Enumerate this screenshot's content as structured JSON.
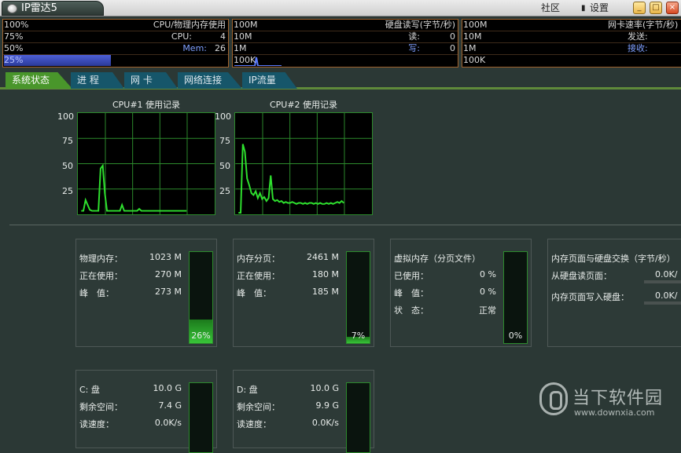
{
  "window": {
    "title": "IP雷达5",
    "community": "社区",
    "settings": "设置",
    "minimize_glyph": "_",
    "maximize_glyph": "□",
    "close_glyph": "×"
  },
  "cpu_panel": {
    "title": "CPU/物理内存使用",
    "rows": [
      "100%",
      "75%",
      "50%",
      "25%"
    ],
    "cpu_label": "CPU:",
    "cpu_value": "4",
    "mem_label": "Mem:",
    "mem_value": "26"
  },
  "disk_panel": {
    "title": "硬盘读写(字节/秒)",
    "rows": [
      "100M",
      "10M",
      "1M",
      "100K"
    ],
    "read_label": "读:",
    "read_value": "0",
    "write_label": "写:",
    "write_value": "0"
  },
  "net_panel": {
    "title": "网卡速率(字节/秒)",
    "rows": [
      "100M",
      "10M",
      "1M",
      "100K"
    ],
    "send_label": "发送:",
    "recv_label": "接收:"
  },
  "tabs": [
    "系统状态",
    "进 程",
    "网 卡",
    "网络连接",
    "IP流量"
  ],
  "charts": {
    "cpu1_title": "CPU#1 使用记录",
    "cpu2_title": "CPU#2 使用记录",
    "yticks": [
      "100",
      "75",
      "50",
      "25"
    ]
  },
  "chart_data": [
    {
      "type": "line",
      "title": "CPU#1 使用记录",
      "ylim": [
        0,
        100
      ],
      "yticks": [
        100,
        75,
        50,
        25
      ],
      "grid": true,
      "values": [
        2,
        2,
        13,
        8,
        3,
        2,
        2,
        2,
        2,
        45,
        48,
        20,
        2,
        2,
        2,
        2,
        2,
        2,
        2,
        8,
        2,
        2,
        2,
        2,
        2,
        2,
        2,
        4,
        2,
        2,
        2,
        2,
        2,
        2,
        2,
        2,
        2,
        2,
        2,
        2,
        2,
        2,
        2,
        2,
        2,
        2,
        2,
        2,
        2,
        2
      ]
    },
    {
      "type": "line",
      "title": "CPU#2 使用记录",
      "ylim": [
        0,
        100
      ],
      "yticks": [
        100,
        75,
        50,
        25
      ],
      "grid": true,
      "values": [
        0,
        0,
        70,
        62,
        35,
        28,
        20,
        18,
        22,
        15,
        20,
        14,
        16,
        12,
        15,
        38,
        14,
        12,
        13,
        11,
        12,
        10,
        11,
        10,
        10,
        11,
        10,
        9,
        10,
        10,
        9,
        10,
        9,
        10,
        10,
        9,
        10,
        9,
        10,
        9,
        9,
        10,
        9,
        10,
        9,
        10,
        11,
        10,
        12,
        10
      ]
    }
  ],
  "physical_memory": {
    "total_label": "物理内存：",
    "total_value": "1023 M",
    "used_label": "正在使用：",
    "used_value": "270 M",
    "peak_label": "峰　值：",
    "peak_value": "273 M",
    "percent": "26%",
    "fill_fraction": 0.26
  },
  "paging": {
    "total_label": "内存分页：",
    "total_value": "2461 M",
    "used_label": "正在使用：",
    "used_value": "180 M",
    "peak_label": "峰　值：",
    "peak_value": "185 M",
    "percent": "7%",
    "fill_fraction": 0.07
  },
  "virtual_memory": {
    "title": "虚拟内存（分页文件）",
    "used_label": "已使用：",
    "used_value": "0 %",
    "peak_label": "峰　值：",
    "peak_value": "0 %",
    "state_label": "状　态：",
    "state_value": "正常",
    "percent": "0%",
    "fill_fraction": 0
  },
  "page_swap": {
    "title": "内存页面与硬盘交换（字节/秒）",
    "read_label": "从硬盘读页面：",
    "read_value": "0.0K/",
    "write_label": "内存页面写入硬盘：",
    "write_value": "0.0K/"
  },
  "drive_c": {
    "label": "C: 盘",
    "size": "10.0 G",
    "free_label": "剩余空间：",
    "free_value": "7.4 G",
    "speed_label": "读速度：",
    "speed_value": "0.0K/s"
  },
  "drive_d": {
    "label": "D: 盘",
    "size": "10.0 G",
    "free_label": "剩余空间：",
    "free_value": "9.9 G",
    "speed_label": "读速度：",
    "speed_value": "0.0K/s"
  },
  "watermark": {
    "name": "当下软件园",
    "url": "www.downxia.com"
  }
}
